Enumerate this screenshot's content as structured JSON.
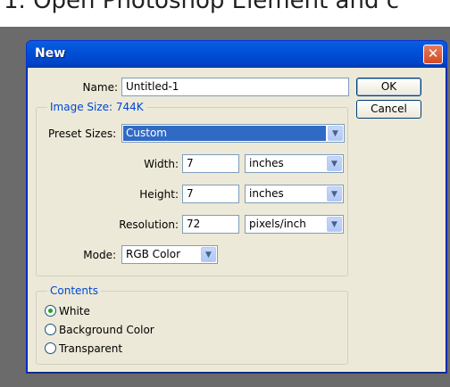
{
  "caption": "1. Open Photoshop Element and c",
  "dialog": {
    "title": "New",
    "close_glyph": "✕"
  },
  "name": {
    "label": "Name:",
    "value": "Untitled-1"
  },
  "buttons": {
    "ok": "OK",
    "cancel": "Cancel"
  },
  "image_size": {
    "label": "Image Size: 744K"
  },
  "preset": {
    "label": "Preset Sizes:",
    "value": "Custom"
  },
  "width": {
    "label": "Width:",
    "value": "7",
    "unit": "inches"
  },
  "height": {
    "label": "Height:",
    "value": "7",
    "unit": "inches"
  },
  "resolution": {
    "label": "Resolution:",
    "value": "72",
    "unit": "pixels/inch"
  },
  "mode": {
    "label": "Mode:",
    "value": "RGB Color"
  },
  "contents": {
    "title": "Contents",
    "options": [
      {
        "label": "White",
        "selected": true
      },
      {
        "label": "Background Color",
        "selected": false
      },
      {
        "label": "Transparent",
        "selected": false
      }
    ]
  },
  "icons": {
    "dropdown": "chevron-down-icon",
    "close": "close-icon"
  },
  "colors": {
    "titlebar": "#0055e5",
    "dialog_bg": "#ece9d8",
    "group_title": "#0046d5",
    "selection": "#316ac5"
  }
}
